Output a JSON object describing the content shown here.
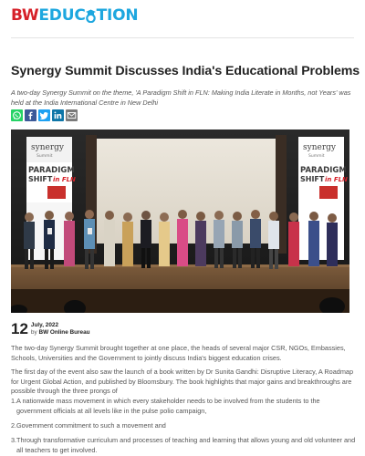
{
  "brand": {
    "part1": "BW",
    "part2": "EDUC",
    "part3": "TION"
  },
  "article": {
    "title": "Synergy Summit Discusses India's Educational Problems",
    "subtitle": "A two-day Synergy Summit on the theme, 'A Paradigm Shift in FLN: Making India Literate in Months, not Years' was held at the India International Centre in New Delhi",
    "share": [
      "whatsapp-icon",
      "facebook-icon",
      "twitter-icon",
      "linkedin-icon",
      "email-icon"
    ],
    "photo_banner": {
      "brand": "synergy",
      "summit": "Summit",
      "line1": "PARADIGM",
      "line2": "SHIFT",
      "line3": "in FLN"
    },
    "day": "12",
    "date": "July, 2022",
    "byline_prefix": "by",
    "author": "BW Online Bureau",
    "paragraph1": "The two-day Synergy Summit brought together at one place, the heads of several major CSR, NGOs, Embassies, Schools, Universities and the Government to jointly discuss India's biggest education crises.",
    "paragraph2": "The first day of the event also saw the launch of a book written by Dr Sunita Gandhi: Disruptive Literacy, A Roadmap for Urgent Global Action, and published by Bloomsbury. The book highlights that major gains and breakthroughs are possible through the three prongs of",
    "list": [
      {
        "num": "1.",
        "text": "A nationwide mass movement in which every stakeholder needs to be involved from the students to the government officials at all levels like in the pulse polio campaign,"
      },
      {
        "num": "2.",
        "text": "Government commitment to such a movement and"
      },
      {
        "num": "3.",
        "text": "Through transformative curriculum and processes of teaching and learning that allows young and old volunteer and all teachers to get involved."
      }
    ]
  },
  "colors": {
    "brand_red": "#d62129",
    "brand_blue": "#1ea7df",
    "whatsapp": "#25d366",
    "facebook": "#3b5998",
    "twitter": "#1da1f2",
    "linkedin": "#0e76a8",
    "email": "#7a7a7a"
  }
}
